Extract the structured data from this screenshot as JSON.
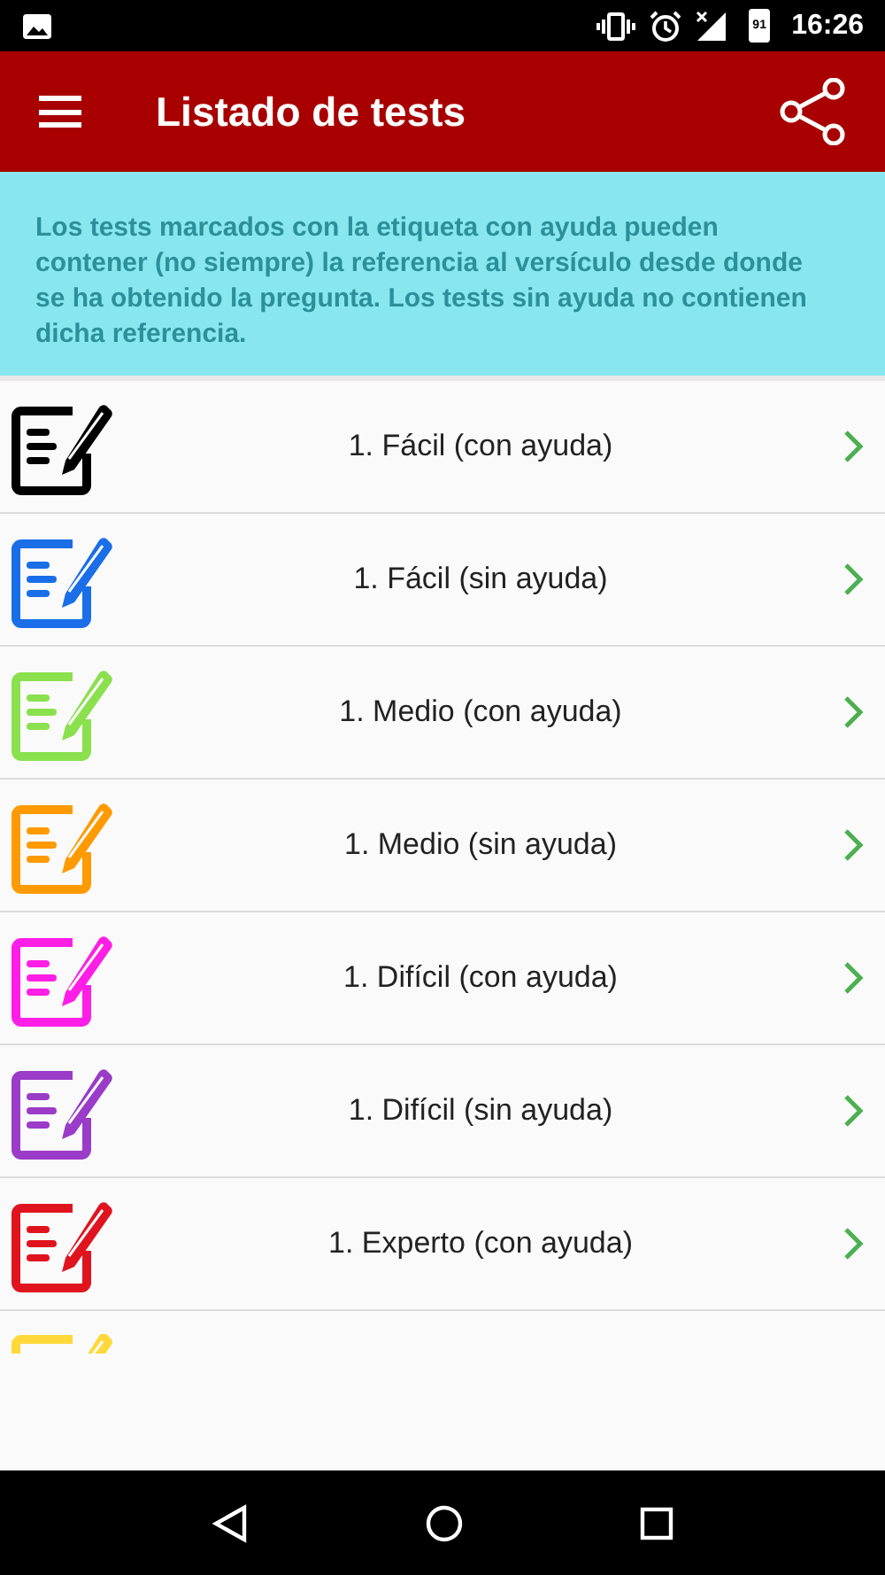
{
  "status_bar": {
    "battery": "91",
    "time": "16:26"
  },
  "toolbar": {
    "title": "Listado de tests"
  },
  "info": "Los tests marcados con la etiqueta con ayuda pueden contener (no siempre) la referencia al versículo desde donde se ha obtenido la pregunta. Los tests sin ayuda no contienen dicha referencia.",
  "tests": [
    {
      "kind": "row",
      "label": "1. Fácil (con ayuda)",
      "color": "#000000"
    },
    {
      "kind": "row",
      "label": "1. Fácil (sin ayuda)",
      "color": "#1a6ee8"
    },
    {
      "kind": "row",
      "label": "1. Medio (con ayuda)",
      "color": "#8be04e"
    },
    {
      "kind": "row",
      "label": "1. Medio (sin ayuda)",
      "color": "#ff9a00"
    },
    {
      "kind": "row",
      "label": "1. Difícil (con ayuda)",
      "color": "#ff1ee6"
    },
    {
      "kind": "row",
      "label": "1. Difícil (sin ayuda)",
      "color": "#9a3cc8"
    },
    {
      "kind": "row",
      "label": "1. Experto (con ayuda)",
      "color": "#e0141e"
    },
    {
      "kind": "clipped",
      "color": "#ffd83a"
    }
  ]
}
